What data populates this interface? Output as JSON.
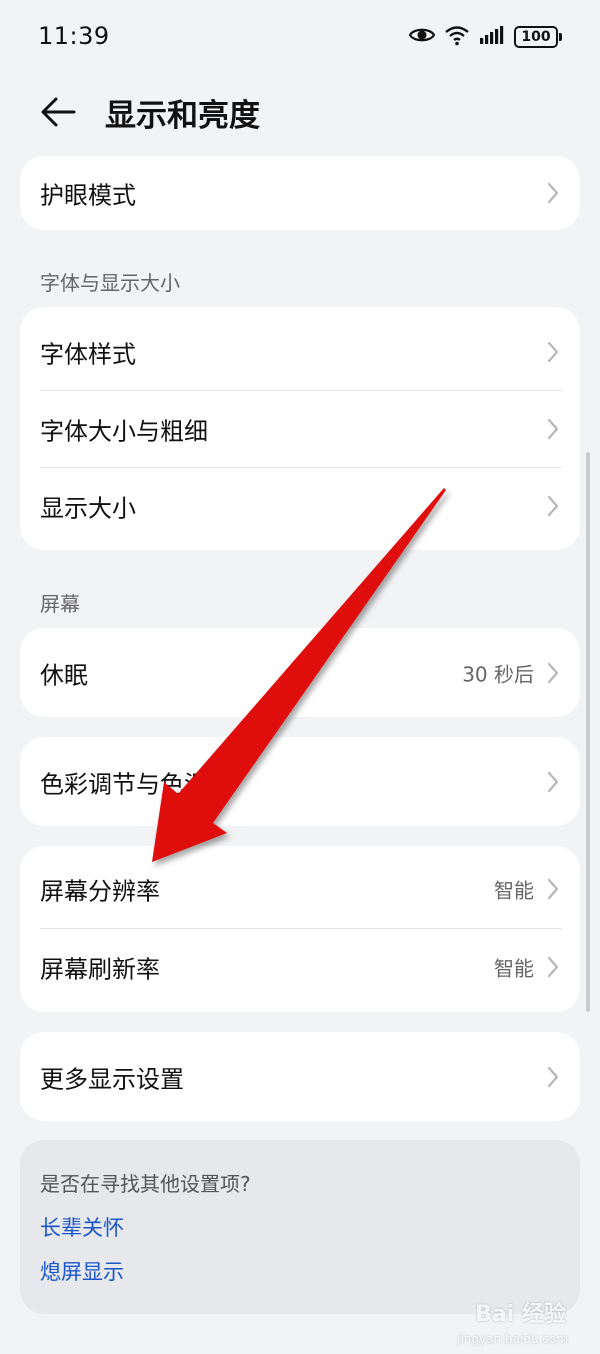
{
  "status_bar": {
    "time": "11:39",
    "battery_level": "100",
    "icons": [
      "eye-icon",
      "wifi-icon",
      "signal-icon",
      "battery-icon"
    ]
  },
  "header": {
    "back_icon": "back-arrow-icon",
    "title": "显示和亮度"
  },
  "eye_card": {
    "label": "护眼模式"
  },
  "font_section": {
    "label": "字体与显示大小",
    "items": [
      {
        "label": "字体样式"
      },
      {
        "label": "字体大小与粗细"
      },
      {
        "label": "显示大小"
      }
    ]
  },
  "screen_section": {
    "label": "屏幕",
    "sleep": {
      "label": "休眠",
      "value": "30 秒后"
    },
    "color": {
      "label": "色彩调节与色温"
    },
    "resolution": {
      "label": "屏幕分辨率",
      "value": "智能"
    },
    "refresh": {
      "label": "屏幕刷新率",
      "value": "智能"
    },
    "more": {
      "label": "更多显示设置"
    }
  },
  "suggestions": {
    "title": "是否在寻找其他设置项?",
    "links": [
      "长辈关怀",
      "熄屏显示"
    ]
  },
  "watermark": {
    "text": "Bai 经验",
    "sub": "jingyan.baidu.com"
  },
  "colors": {
    "background": "#f1f3f5",
    "card": "#ffffff",
    "link": "#1a56c9",
    "annotation_arrow": "#e01010"
  }
}
